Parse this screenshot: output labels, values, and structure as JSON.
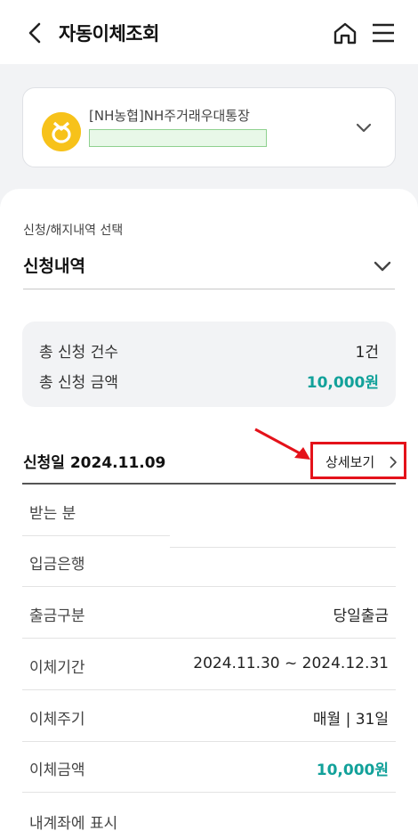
{
  "header": {
    "title": "자동이체조회",
    "back_icon": "chevron-left-icon",
    "home_icon": "home-icon",
    "menu_icon": "hamburger-menu-icon"
  },
  "account": {
    "name": "[NH농협]NH주거래우대통장",
    "logo_icon": "nh-bank-logo-icon",
    "chevron_icon": "chevron-down-icon"
  },
  "filter": {
    "label": "신청/해지내역 선택",
    "value": "신청내역"
  },
  "summary": {
    "count_label": "총 신청 건수",
    "count_value": "1건",
    "amount_label": "총 신청 금액",
    "amount_value": "10,000원"
  },
  "item": {
    "date_label": "신청일 2024.11.09",
    "detail_label": "상세보기",
    "rows": [
      {
        "key": "받는 분",
        "value": ""
      },
      {
        "key": "입금은행",
        "value": ""
      },
      {
        "key": "출금구분",
        "value": "당일출금"
      },
      {
        "key": "이체기간",
        "value": "2024.11.30 ~ 2024.12.31"
      },
      {
        "key": "이체주기",
        "value": "매월 | 31일"
      },
      {
        "key": "이체금액",
        "value": "10,000원"
      },
      {
        "key": "내계좌에 표시",
        "value": ""
      }
    ]
  },
  "colors": {
    "accent": "#12a19a",
    "highlight_box": "#e4121a",
    "bank_logo": "#f7c21a"
  }
}
